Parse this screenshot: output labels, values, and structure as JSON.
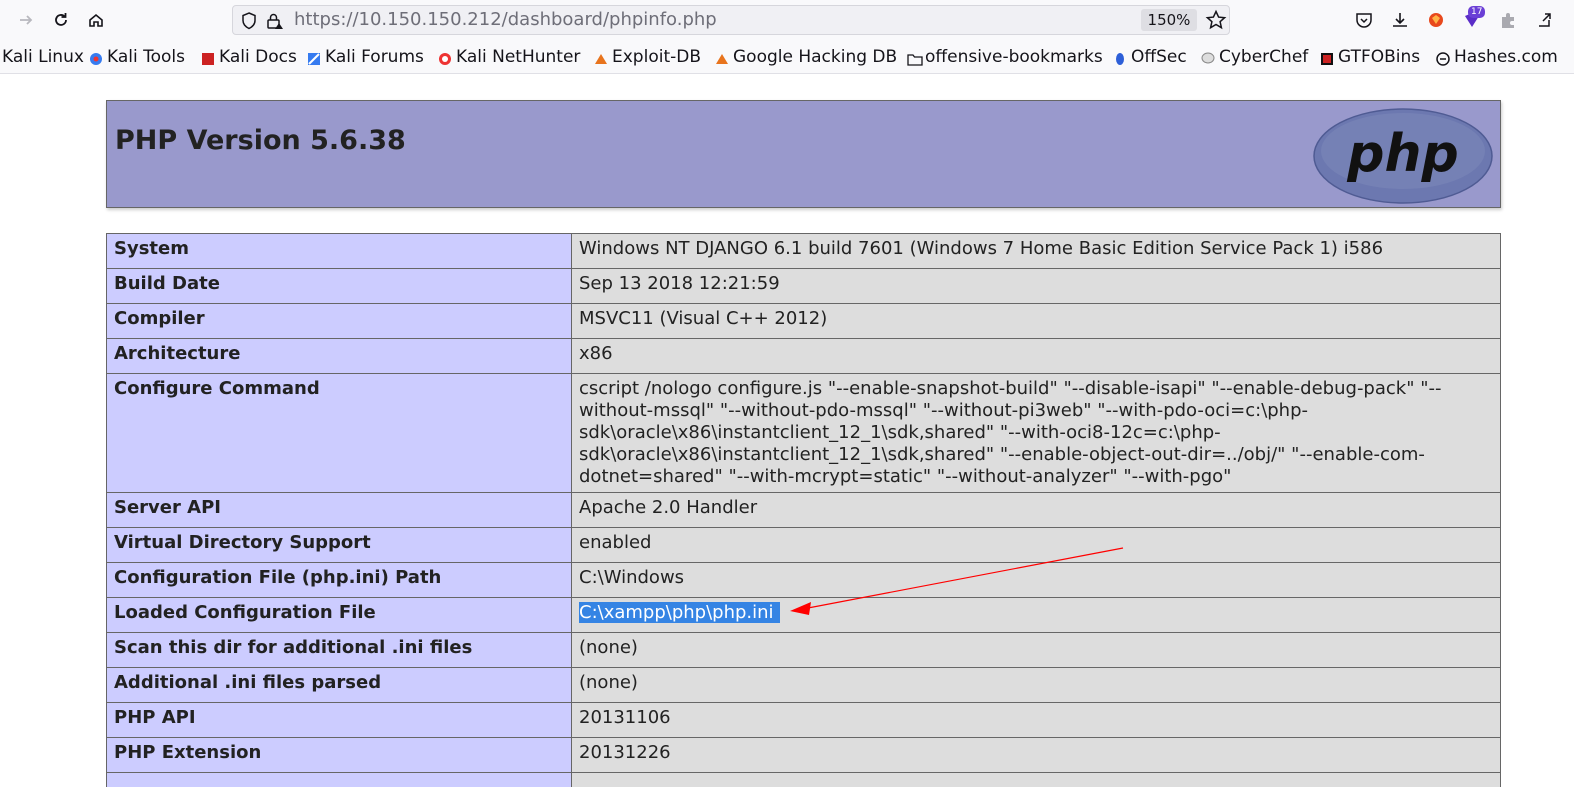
{
  "browser": {
    "url_host": "https://10.150.150.212",
    "url_path": "/dashboard/phpinfo.php",
    "zoom": "150%",
    "extension_badge": "17"
  },
  "bookmarks": [
    {
      "label": "Kali Linux"
    },
    {
      "label": "Kali Tools"
    },
    {
      "label": "Kali Docs"
    },
    {
      "label": "Kali Forums"
    },
    {
      "label": "Kali NetHunter"
    },
    {
      "label": "Exploit-DB"
    },
    {
      "label": "Google Hacking DB"
    },
    {
      "label": "offensive-bookmarks"
    },
    {
      "label": "OffSec"
    },
    {
      "label": "CyberChef"
    },
    {
      "label": "GTFOBins"
    },
    {
      "label": "Hashes.com"
    }
  ],
  "phpinfo": {
    "title": "PHP Version 5.6.38",
    "logo_text": "php",
    "rows": [
      {
        "key": "System",
        "value": "Windows NT DJANGO 6.1 build 7601 (Windows 7 Home Basic Edition Service Pack 1) i586"
      },
      {
        "key": "Build Date",
        "value": "Sep 13 2018 12:21:59"
      },
      {
        "key": "Compiler",
        "value": "MSVC11 (Visual C++ 2012)"
      },
      {
        "key": "Architecture",
        "value": "x86"
      },
      {
        "key": "Configure Command",
        "value": "cscript /nologo configure.js \"--enable-snapshot-build\" \"--disable-isapi\" \"--enable-debug-pack\" \"--without-mssql\" \"--without-pdo-mssql\" \"--without-pi3web\" \"--with-pdo-oci=c:\\php-sdk\\oracle\\x86\\instantclient_12_1\\sdk,shared\" \"--with-oci8-12c=c:\\php-sdk\\oracle\\x86\\instantclient_12_1\\sdk,shared\" \"--enable-object-out-dir=../obj/\" \"--enable-com-dotnet=shared\" \"--with-mcrypt=static\" \"--without-analyzer\" \"--with-pgo\""
      },
      {
        "key": "Server API",
        "value": "Apache 2.0 Handler"
      },
      {
        "key": "Virtual Directory Support",
        "value": "enabled"
      },
      {
        "key": "Configuration File (php.ini) Path",
        "value": "C:\\Windows"
      },
      {
        "key": "Loaded Configuration File",
        "value": "C:\\xampp\\php\\php.ini"
      },
      {
        "key": "Scan this dir for additional .ini files",
        "value": "(none)"
      },
      {
        "key": "Additional .ini files parsed",
        "value": "(none)"
      },
      {
        "key": "PHP API",
        "value": "20131106"
      },
      {
        "key": "PHP Extension",
        "value": "20131226"
      },
      {
        "key": "",
        "value": ""
      }
    ]
  },
  "colors": {
    "header_bg": "#9999cc",
    "key_bg": "#ccccff",
    "value_bg": "#dddddd",
    "selection": "#3584e4",
    "annotation_arrow": "#ff0000"
  }
}
